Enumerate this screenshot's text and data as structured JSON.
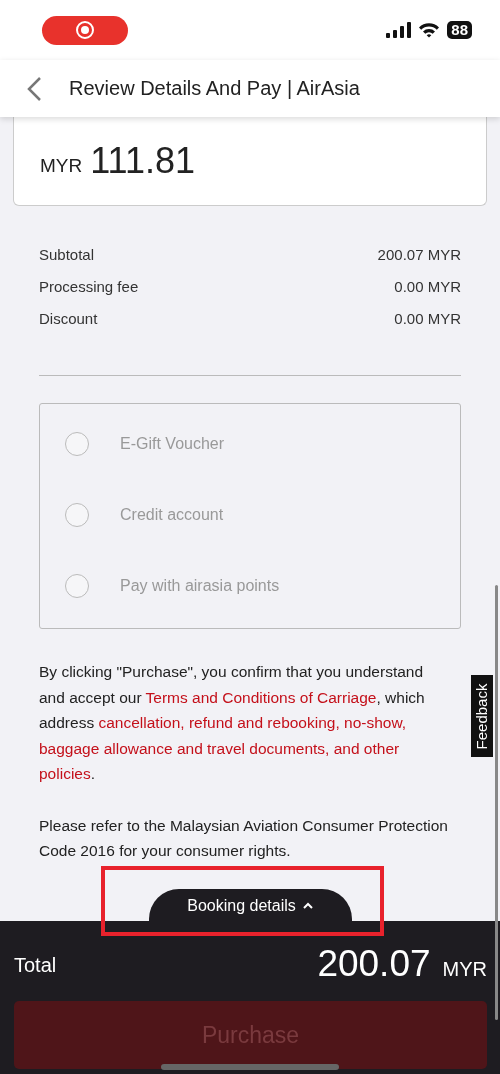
{
  "status_bar": {
    "battery": "88"
  },
  "header": {
    "title": "Review Details And Pay | AirAsia"
  },
  "amount_card": {
    "currency": "MYR",
    "amount": "111.81"
  },
  "summary": [
    {
      "label": "Subtotal",
      "value": "200.07 MYR"
    },
    {
      "label": "Processing fee",
      "value": "0.00 MYR"
    },
    {
      "label": "Discount",
      "value": "0.00 MYR"
    }
  ],
  "payment_options": [
    {
      "label": "E-Gift Voucher",
      "selected": false,
      "disabled": true
    },
    {
      "label": "Credit account",
      "selected": false,
      "disabled": true
    },
    {
      "label": "Pay with airasia points",
      "selected": false,
      "disabled": true
    }
  ],
  "terms": [
    [
      {
        "kind": "text",
        "text": "By clicking \"Purchase\", you confirm that you understand"
      }
    ],
    [
      {
        "kind": "text",
        "text": "and accept our "
      },
      {
        "kind": "link",
        "text": "Terms and Conditions of Carriage"
      },
      {
        "kind": "text",
        "text": ", which"
      }
    ],
    [
      {
        "kind": "text",
        "text": "address "
      },
      {
        "kind": "link",
        "text": "cancellation, refund and rebooking, no-show,"
      }
    ],
    [
      {
        "kind": "link",
        "text": "baggage allowance and travel documents, and other"
      }
    ],
    [
      {
        "kind": "link",
        "text": "policies"
      },
      {
        "kind": "text",
        "text": "."
      }
    ]
  ],
  "consumer_note": "Please refer to the Malaysian Aviation Consumer Protection Code 2016 for your consumer rights.",
  "feedback_tab": "Feedback",
  "booking_details": {
    "label": "Booking details",
    "expanded": false,
    "highlighted": true
  },
  "total": {
    "label": "Total",
    "amount": "200.07",
    "currency": "MYR"
  },
  "purchase_button": {
    "label": "Purchase",
    "disabled": true
  }
}
